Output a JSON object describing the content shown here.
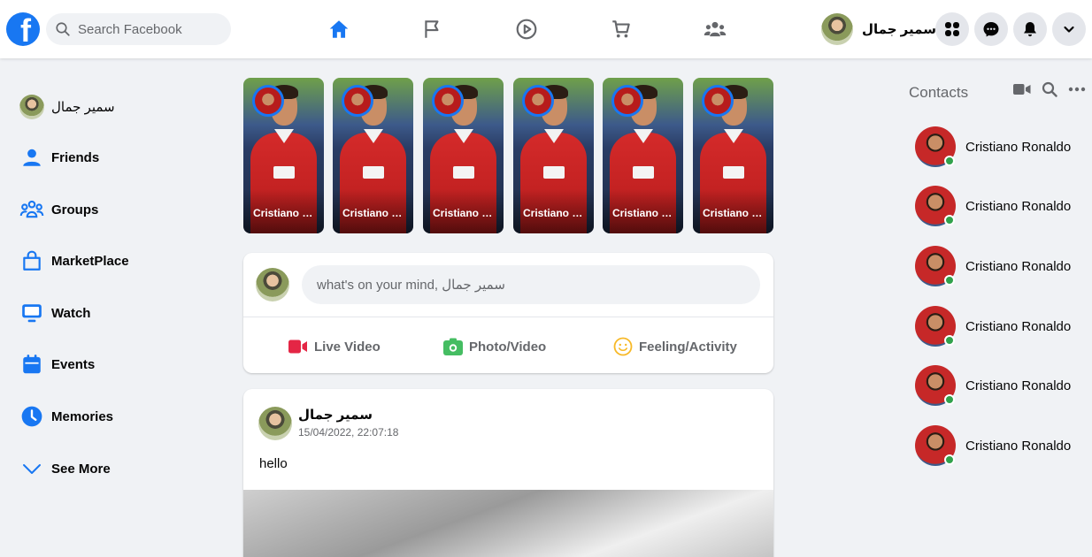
{
  "header": {
    "search_placeholder": "Search Facebook",
    "user_name": "سمير جمال",
    "logo_letter": "f"
  },
  "nav_icons": [
    "home-icon",
    "pages-flag-icon",
    "watch-play-icon",
    "marketplace-cart-icon",
    "groups-icon"
  ],
  "header_buttons": [
    "menu-grid-icon",
    "messenger-icon",
    "notifications-bell-icon",
    "account-chevron-icon"
  ],
  "colors": {
    "brand": "#1877f2",
    "background": "#f0f2f5",
    "live": "#e42645",
    "photo": "#45bd62",
    "feeling": "#f7b928",
    "online": "#31a24c"
  },
  "sidebar": {
    "items": [
      {
        "label": "سمير جمال",
        "icon": "profile-avatar"
      },
      {
        "label": "Friends",
        "icon": "friends-icon"
      },
      {
        "label": "Groups",
        "icon": "groups-icon"
      },
      {
        "label": "MarketPlace",
        "icon": "marketplace-bag-icon"
      },
      {
        "label": "Watch",
        "icon": "watch-tv-icon"
      },
      {
        "label": "Events",
        "icon": "events-calendar-icon"
      },
      {
        "label": "Memories",
        "icon": "memories-clock-icon"
      },
      {
        "label": "See More",
        "icon": "chevron-down-icon"
      }
    ]
  },
  "stories": [
    {
      "name": "Cristiano Ronaldo"
    },
    {
      "name": "Cristiano Ronaldo"
    },
    {
      "name": "Cristiano Ronaldo"
    },
    {
      "name": "Cristiano Ronaldo"
    },
    {
      "name": "Cristiano Ronaldo"
    },
    {
      "name": "Cristiano Ronaldo"
    }
  ],
  "composer": {
    "placeholder": "what's on your mind, سمير جمال",
    "actions": [
      {
        "label": "Live Video",
        "icon": "live-video-icon"
      },
      {
        "label": "Photo/Video",
        "icon": "photo-icon"
      },
      {
        "label": "Feeling/Activity",
        "icon": "feeling-smile-icon"
      }
    ]
  },
  "post": {
    "author": "سمير جمال",
    "timestamp": "15/04/2022, 22:07:18",
    "text": "hello"
  },
  "contacts": {
    "title": "Contacts",
    "tools": [
      "video-call-icon",
      "search-icon",
      "more-options-icon"
    ],
    "people": [
      {
        "name": "Cristiano Ronaldo",
        "online": true
      },
      {
        "name": "Cristiano Ronaldo",
        "online": true
      },
      {
        "name": "Cristiano Ronaldo",
        "online": true
      },
      {
        "name": "Cristiano Ronaldo",
        "online": true
      },
      {
        "name": "Cristiano Ronaldo",
        "online": true
      },
      {
        "name": "Cristiano Ronaldo",
        "online": true
      }
    ]
  }
}
